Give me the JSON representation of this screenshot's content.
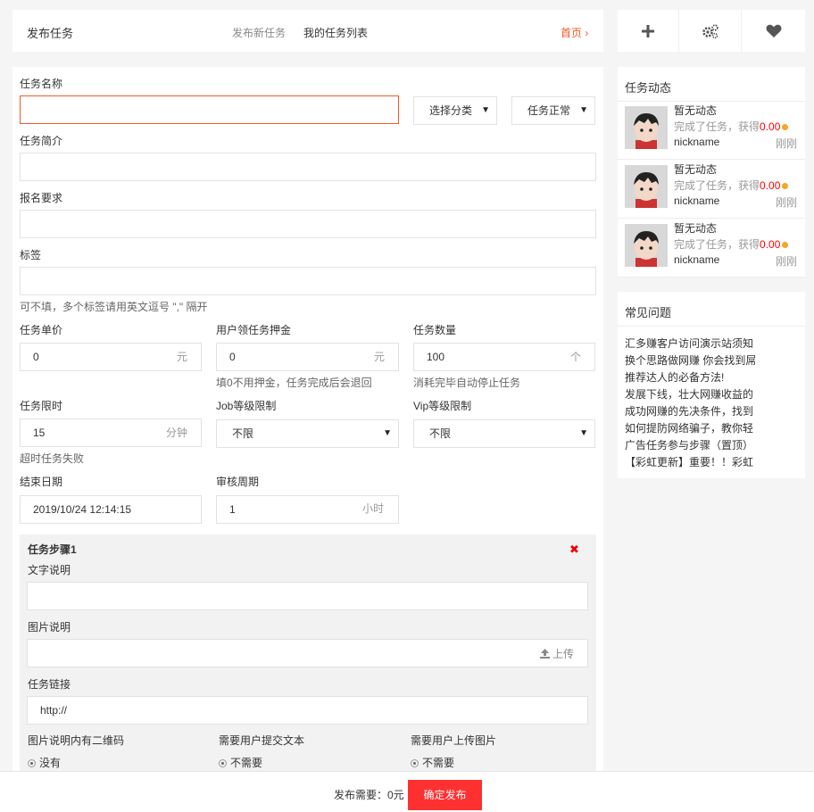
{
  "header": {
    "title": "发布任务",
    "nav": [
      "发布新任务",
      "我的任务列表"
    ],
    "home_link": "首页 ›"
  },
  "toolbar": {
    "icons": [
      "plus-icon",
      "gears-icon",
      "heart-icon"
    ]
  },
  "form": {
    "task_name": {
      "label": "任务名称",
      "value": ""
    },
    "category_select": {
      "value": "选择分类"
    },
    "status_select": {
      "value": "任务正常"
    },
    "summary": {
      "label": "任务简介",
      "value": ""
    },
    "requirements": {
      "label": "报名要求",
      "value": ""
    },
    "tags": {
      "label": "标签",
      "value": "",
      "hint": "可不填，多个标签请用英文逗号 \",\" 隔开"
    },
    "unit_price": {
      "label": "任务单价",
      "value": "0",
      "unit": "元"
    },
    "deposit": {
      "label": "用户领任务押金",
      "value": "0",
      "unit": "元",
      "hint": "填0不用押金，任务完成后会退回"
    },
    "quantity": {
      "label": "任务数量",
      "value": "100",
      "unit": "个",
      "hint": "消耗完毕自动停止任务"
    },
    "time_limit": {
      "label": "任务限时",
      "value": "15",
      "unit": "分钟",
      "hint": "超时任务失败"
    },
    "job_level": {
      "label": "Job等级限制",
      "value": "不限"
    },
    "vip_level": {
      "label": "Vip等级限制",
      "value": "不限"
    },
    "end_date": {
      "label": "结束日期",
      "value": "2019/10/24 12:14:15"
    },
    "review_period": {
      "label": "审核周期",
      "value": "1",
      "unit": "小时"
    }
  },
  "step": {
    "title": "任务步骤1",
    "text_label": "文字说明",
    "text_value": "",
    "image_label": "图片说明",
    "upload_label": "上传",
    "link_label": "任务链接",
    "link_value": "http://",
    "qr_label": "图片说明内有二维码",
    "qr_option": "没有",
    "submit_text_label": "需要用户提交文本",
    "submit_text_option": "不需要",
    "upload_image_label": "需要用户上传图片",
    "upload_image_option": "不需要"
  },
  "feed": {
    "title": "任务动态",
    "items": [
      {
        "title": "暂无动态",
        "action": "完成了任务，获得",
        "amount": "0.00",
        "user": "nickname",
        "time": "刚刚"
      },
      {
        "title": "暂无动态",
        "action": "完成了任务，获得",
        "amount": "0.00",
        "user": "nickname",
        "time": "刚刚"
      },
      {
        "title": "暂无动态",
        "action": "完成了任务，获得",
        "amount": "0.00",
        "user": "nickname",
        "time": "刚刚"
      }
    ]
  },
  "faq": {
    "title": "常见问题",
    "lines": [
      "汇多赚客户访问演示站须知",
      "换个思路做网赚 你会找到屌",
      "推荐达人的必备方法!",
      "发展下线，壮大网赚收益的",
      "成功网赚的先决条件，找到",
      "如何提防网络骗子，教你轻",
      "广告任务参与步骤（置顶）",
      "【彩虹更新】重要！！彩虹"
    ]
  },
  "footer": {
    "cost_text": "发布需要：0元",
    "submit_label": "确定发布"
  },
  "colors": {
    "accent": "#f05a28",
    "danger": "#ff3030",
    "coin": "#f5a623"
  }
}
